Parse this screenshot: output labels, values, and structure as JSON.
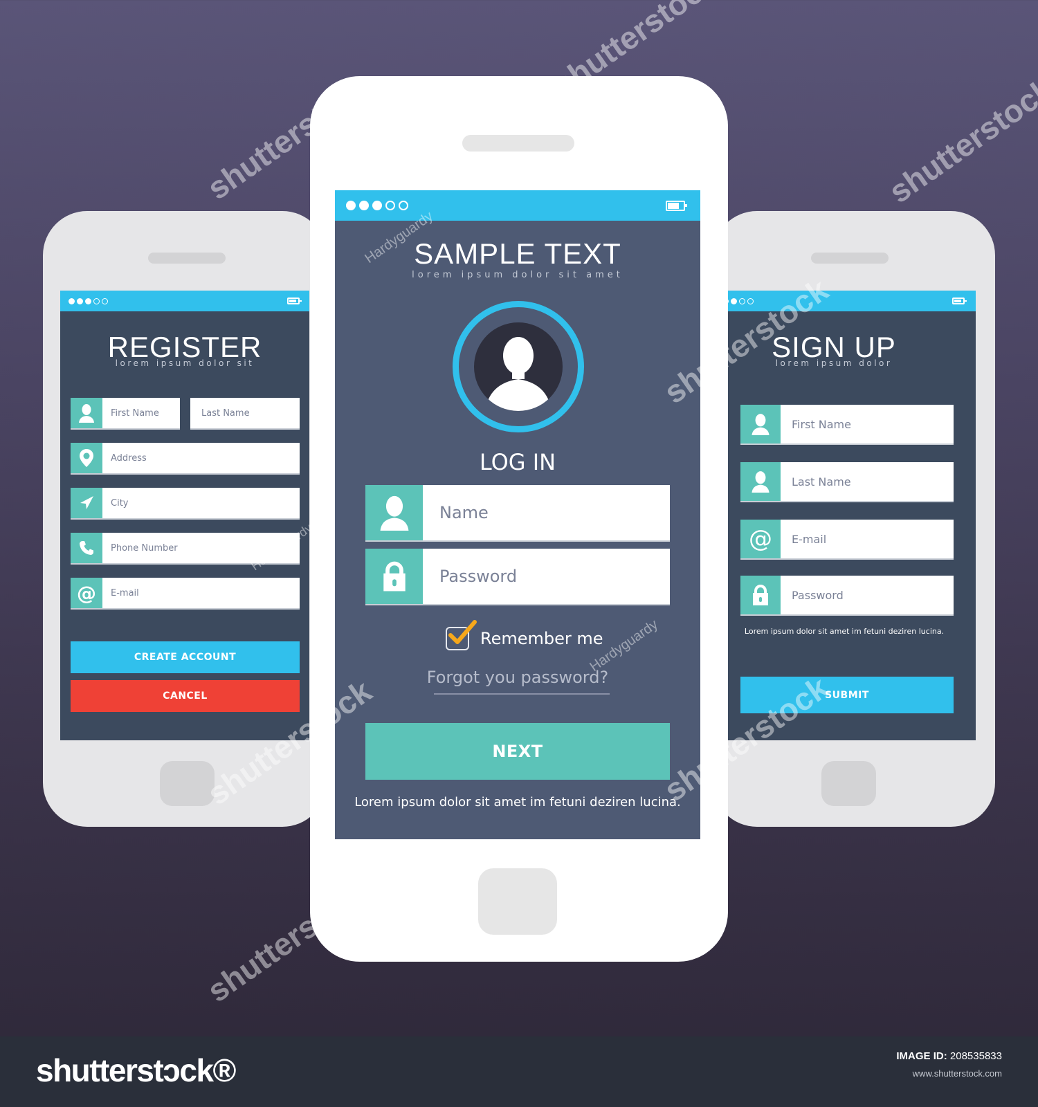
{
  "colors": {
    "background_top": "#5a5578",
    "background_bottom": "#2d2737",
    "status_bar": "#31c0ec",
    "icon_teal": "#5cc3b8",
    "screen_dark": "#3c4a5e",
    "screen_center": "#4e5a74",
    "primary_blue": "#31c0ec",
    "danger_red": "#ef4136",
    "next_teal": "#5cc3b8",
    "checkmark_orange": "#f7a81b"
  },
  "status_bar": {
    "signal_dots": {
      "filled": 3,
      "total": 5
    },
    "battery_icon": "battery-icon"
  },
  "register_screen": {
    "title": "REGISTER",
    "subtitle": "lorem ipsum dolor sit",
    "fields": {
      "first_name": {
        "placeholder": "First Name",
        "icon": "user-icon"
      },
      "last_name": {
        "placeholder": "Last Name"
      },
      "address": {
        "placeholder": "Address",
        "icon": "map-pin-icon"
      },
      "city": {
        "placeholder": "City",
        "icon": "navigation-arrow-icon"
      },
      "phone": {
        "placeholder": "Phone Number",
        "icon": "phone-icon"
      },
      "email": {
        "placeholder": "E-mail",
        "icon": "at-icon"
      }
    },
    "create_account_label": "CREATE ACCOUNT",
    "cancel_label": "CANCEL"
  },
  "login_screen": {
    "title": "SAMPLE TEXT",
    "subtitle": "lorem ipsum dolor sit amet",
    "avatar_icon": "user-avatar-icon",
    "heading": "LOG IN",
    "fields": {
      "name": {
        "placeholder": "Name",
        "icon": "user-icon"
      },
      "password": {
        "placeholder": "Password",
        "icon": "lock-icon"
      }
    },
    "remember_me": {
      "label": "Remember me",
      "checked": true
    },
    "forgot_password_label": "Forgot you password?",
    "next_label": "NEXT",
    "footer_note": "Lorem ipsum dolor sit amet im fetuni deziren lucina."
  },
  "signup_screen": {
    "title": "SIGN UP",
    "subtitle": "lorem ipsum dolor",
    "fields": {
      "first_name": {
        "placeholder": "First Name",
        "icon": "user-icon"
      },
      "last_name": {
        "placeholder": "Last Name",
        "icon": "user-icon"
      },
      "email": {
        "placeholder": "E-mail",
        "icon": "at-icon"
      },
      "password": {
        "placeholder": "Password",
        "icon": "lock-icon"
      }
    },
    "note": "Lorem ipsum dolor sit amet im fetuni deziren lucina.",
    "submit_label": "SUBMIT"
  },
  "watermarks": {
    "brand": "shutterstock",
    "author": "Hardyguardy"
  },
  "footer": {
    "brand": "shutterstɔck®",
    "image_id_label": "IMAGE ID:",
    "image_id": "208535833",
    "website": "www.shutterstock.com"
  }
}
